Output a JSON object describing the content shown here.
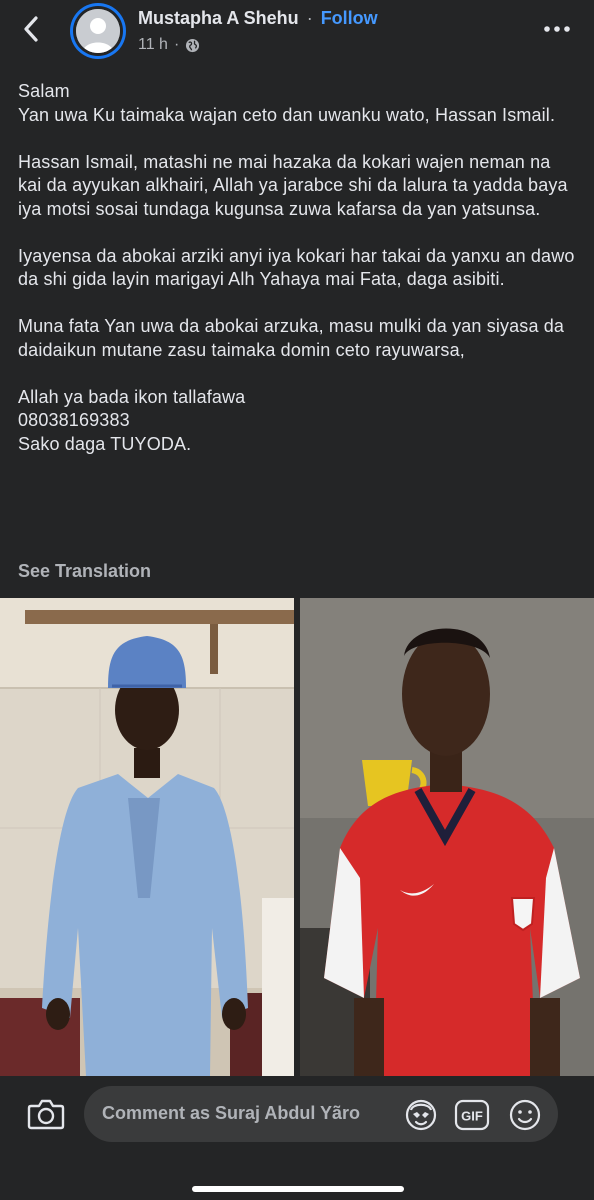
{
  "header": {
    "author_name": "Mustapha A Shehu",
    "separator": "·",
    "follow_label": "Follow",
    "timestamp": "11 h",
    "meta_separator": "·",
    "privacy_icon": "globe-icon",
    "back_icon": "chevron-left-icon",
    "more_icon": "more-horizontal-icon"
  },
  "post": {
    "paragraphs": [
      "Salam\nYan uwa Ku taimaka wajan ceto dan uwanku wato, Hassan Ismail.",
      "Hassan Ismail, matashi ne mai hazaka da kokari wajen neman na kai da ayyukan alkhairi, Allah ya jarabce shi da lalura ta yadda baya iya motsi sosai tundaga kugunsa zuwa kafarsa da yan yatsunsa.",
      "Iyayensa da abokai arziki anyi iya kokari har takai da yanxu an dawo da shi gida layin marigayi Alh Yahaya mai Fata, daga asibiti.",
      "Muna fata Yan uwa da abokai arzuka, masu mulki da yan siyasa da daidaikun mutane zasu taimaka domin ceto rayuwarsa,",
      "Allah ya bada ikon tallafawa\n08038169383\nSako daga TUYODA."
    ],
    "see_translation": "See Translation"
  },
  "photos": [
    {
      "name": "man-in-blue-kaftan-photo"
    },
    {
      "name": "man-in-red-jersey-photo"
    }
  ],
  "composer": {
    "camera_icon": "camera-icon",
    "placeholder": "Comment as Suraj Abdul Yãro",
    "avatar_sticker_icon": "avatar-sticker-icon",
    "gif_label": "GIF",
    "emoji_icon": "smiley-icon"
  },
  "colors": {
    "background": "#242526",
    "text": "#e4e6eb",
    "secondary_text": "#b0b3b8",
    "link": "#4599ff",
    "input_bg": "#3a3b3c"
  }
}
